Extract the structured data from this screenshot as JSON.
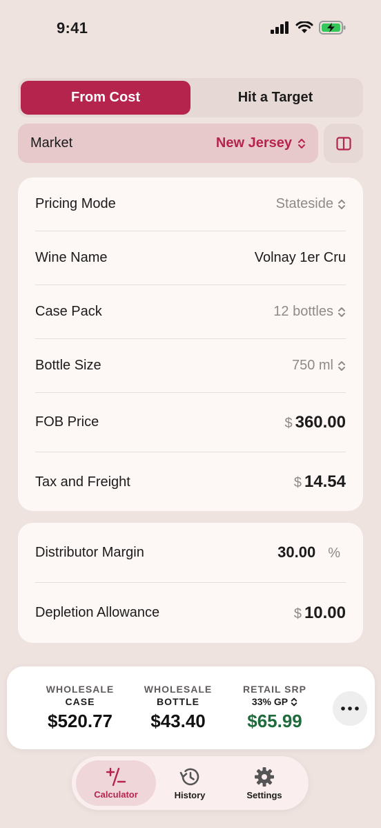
{
  "status_bar": {
    "time": "9:41"
  },
  "mode_tabs": [
    {
      "label": "From Cost",
      "active": true
    },
    {
      "label": "Hit a Target",
      "active": false
    }
  ],
  "market": {
    "label": "Market",
    "value": "New Jersey"
  },
  "pricing": {
    "pricing_mode": {
      "label": "Pricing Mode",
      "value": "Stateside"
    },
    "wine_name": {
      "label": "Wine Name",
      "value": "Volnay 1er Cru"
    },
    "case_pack": {
      "label": "Case Pack",
      "value": "12 bottles"
    },
    "bottle_size": {
      "label": "Bottle Size",
      "value": "750 ml"
    },
    "fob_price": {
      "label": "FOB Price",
      "currency": "$",
      "value": "360.00"
    },
    "tax_freight": {
      "label": "Tax and Freight",
      "currency": "$",
      "value": "14.54"
    }
  },
  "margins": {
    "distributor_margin": {
      "label": "Distributor Margin",
      "value": "30.00",
      "unit": "%"
    },
    "depletion_allowance": {
      "label": "Depletion Allowance",
      "currency": "$",
      "value": "10.00"
    }
  },
  "summary": {
    "wholesale_case": {
      "label_top": "WHOLESALE",
      "label_bottom": "CASE",
      "value": "$520.77"
    },
    "wholesale_bottle": {
      "label_top": "WHOLESALE",
      "label_bottom": "BOTTLE",
      "value": "$43.40"
    },
    "retail_srp": {
      "label_top": "RETAIL SRP",
      "gp_label": "33% GP",
      "value": "$65.99"
    }
  },
  "tab_bar": [
    {
      "label": "Calculator",
      "icon": "plus-minus-icon",
      "active": true
    },
    {
      "label": "History",
      "icon": "history-icon",
      "active": false
    },
    {
      "label": "Settings",
      "icon": "gear-icon",
      "active": false
    }
  ],
  "colors": {
    "accent": "#b5244d",
    "background": "#efe3e0",
    "card": "#fdf7f5",
    "retail_value": "#1e6b3c"
  }
}
